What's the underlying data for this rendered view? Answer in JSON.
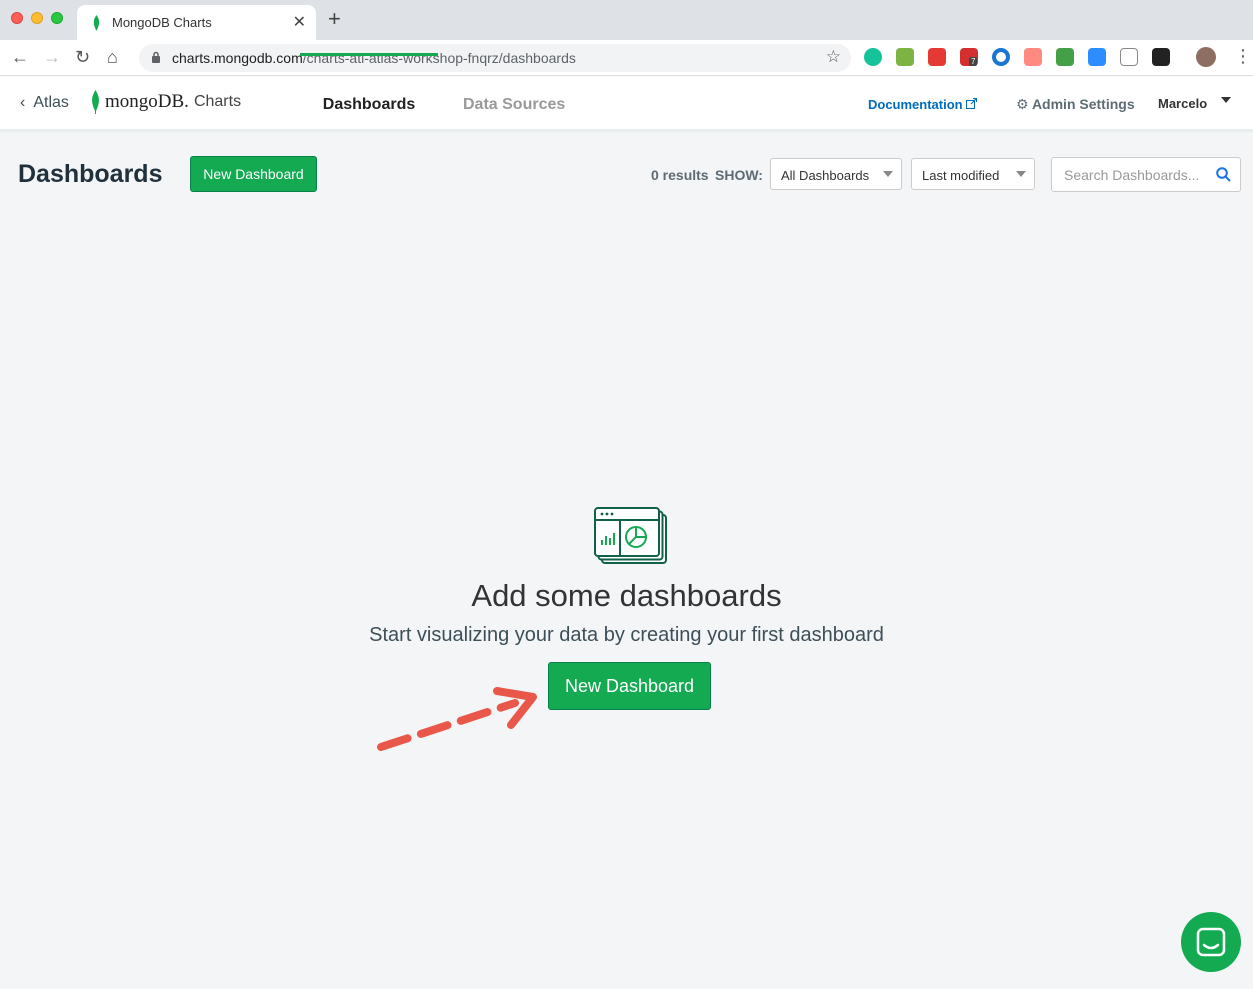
{
  "browser": {
    "tab_title": "MongoDB Charts",
    "url_host": "charts.mongodb.com",
    "url_path": "/charts-atl-atlas-workshop-fnqrz/dashboards",
    "extension_badge": "7"
  },
  "header": {
    "back_label": "Atlas",
    "logo_word": "mongoDB.",
    "logo_product": "Charts",
    "tabs": [
      {
        "label": "Dashboards",
        "active": true
      },
      {
        "label": "Data Sources",
        "active": false
      }
    ],
    "documentation_label": "Documentation",
    "admin_label": "Admin Settings",
    "user_name": "Marcelo"
  },
  "toolbar": {
    "page_title": "Dashboards",
    "new_button_label": "New Dashboard",
    "results_text": "0 results",
    "show_label": "SHOW:",
    "filter_selected": "All Dashboards",
    "sort_selected": "Last modified",
    "search_placeholder": "Search Dashboards..."
  },
  "empty_state": {
    "title": "Add some dashboards",
    "subtitle": "Start visualizing your data by creating your first dashboard",
    "button_label": "New Dashboard"
  },
  "colors": {
    "brand_green": "#13aa52",
    "link_blue": "#006cbc",
    "annotation_arrow": "#e9574a"
  }
}
